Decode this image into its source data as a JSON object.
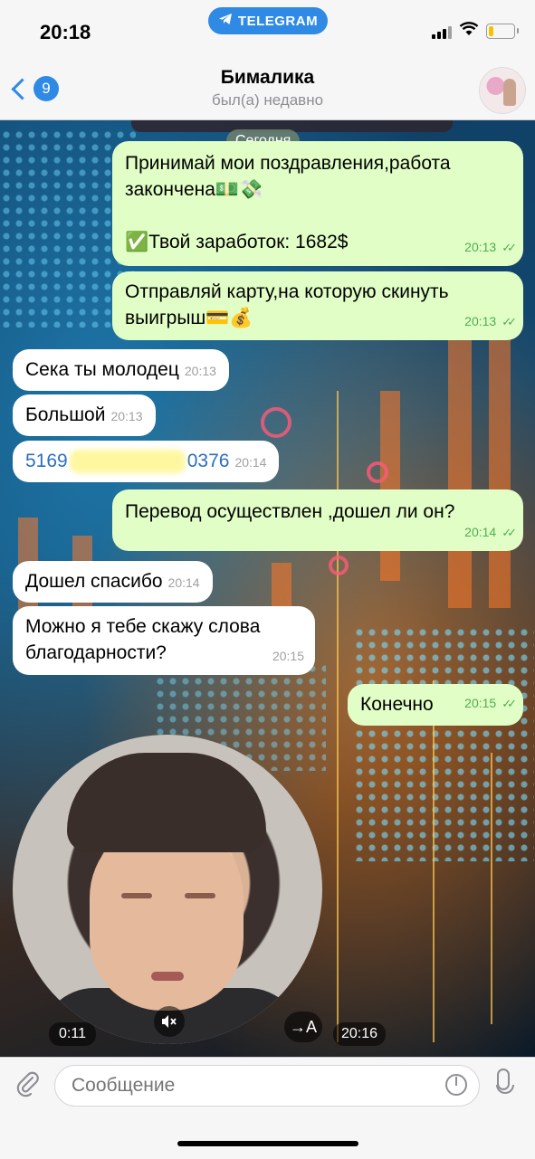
{
  "status_bar": {
    "time": "20:18",
    "app_pill": "TELEGRAM",
    "battery_level": 0.2,
    "battery_color": "#f5c400"
  },
  "header": {
    "back_badge": "9",
    "title": "Бималика",
    "subtitle": "был(а) недавно"
  },
  "chat": {
    "date_separator": "Сегодня",
    "messages": [
      {
        "direction": "out",
        "text_line1": "Принимай мои поздравления,работа",
        "text_line2": "закончена💵💸",
        "text_line3": "✅Твой заработок: 1682$",
        "time": "20:13"
      },
      {
        "direction": "out",
        "text_line1": "Отправляй карту,на которую скинуть",
        "text_line2": "выигрыш💳💰",
        "time": "20:13"
      },
      {
        "direction": "in",
        "text": "Сека ты молодец",
        "time": "20:13"
      },
      {
        "direction": "in",
        "text": "Большой",
        "time": "20:13"
      },
      {
        "direction": "in",
        "card_start": "5169",
        "card_end": "0376",
        "time": "20:14"
      },
      {
        "direction": "out",
        "text": "Перевод осуществлен ,дошел ли он?",
        "time": "20:14"
      },
      {
        "direction": "in",
        "text": "Дошел спасибо",
        "time": "20:14"
      },
      {
        "direction": "in",
        "text_line1": "Можно я тебе скажу слова",
        "text_line2": "благодарности?",
        "time": "20:15"
      },
      {
        "direction": "out",
        "text": "Конечно",
        "time": "20:15"
      }
    ],
    "video_message": {
      "duration": "0:11",
      "translate_label": "→A",
      "time": "20:16",
      "muted_icon": "speaker-muted-icon"
    }
  },
  "composer": {
    "placeholder": "Сообщение"
  },
  "colors": {
    "accent": "#2f8ae5",
    "outgoing_bubble": "#e1fec6",
    "incoming_bubble": "#ffffff",
    "read_check": "#4fae4e"
  }
}
